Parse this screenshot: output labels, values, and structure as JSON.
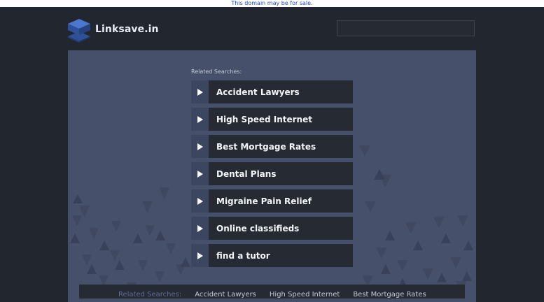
{
  "topbar": {
    "sale_text": "This domain may be for sale."
  },
  "header": {
    "site_name": "Linksave.in",
    "search": {
      "value": "",
      "placeholder": ""
    }
  },
  "main": {
    "related_label": "Related Searches:",
    "links": [
      {
        "label": "Accident Lawyers"
      },
      {
        "label": "High Speed Internet"
      },
      {
        "label": "Best Mortgage Rates"
      },
      {
        "label": "Dental Plans"
      },
      {
        "label": "Migraine Pain Relief"
      },
      {
        "label": "Online classifieds"
      },
      {
        "label": "find a tutor"
      }
    ]
  },
  "footer": {
    "related_label": "Related Searches:",
    "links": [
      "Accident Lawyers",
      "High Speed Internet",
      "Best Mortgage Rates"
    ]
  },
  "colors": {
    "page_bg": "#22262f",
    "panel_bg": "#46506a",
    "link_bg": "#262a33",
    "arrow_bg": "#3c4660",
    "sale_link": "#2244cc"
  },
  "icons": {
    "logo": "stacked-layers-icon",
    "link_arrow": "play-triangle-icon"
  }
}
